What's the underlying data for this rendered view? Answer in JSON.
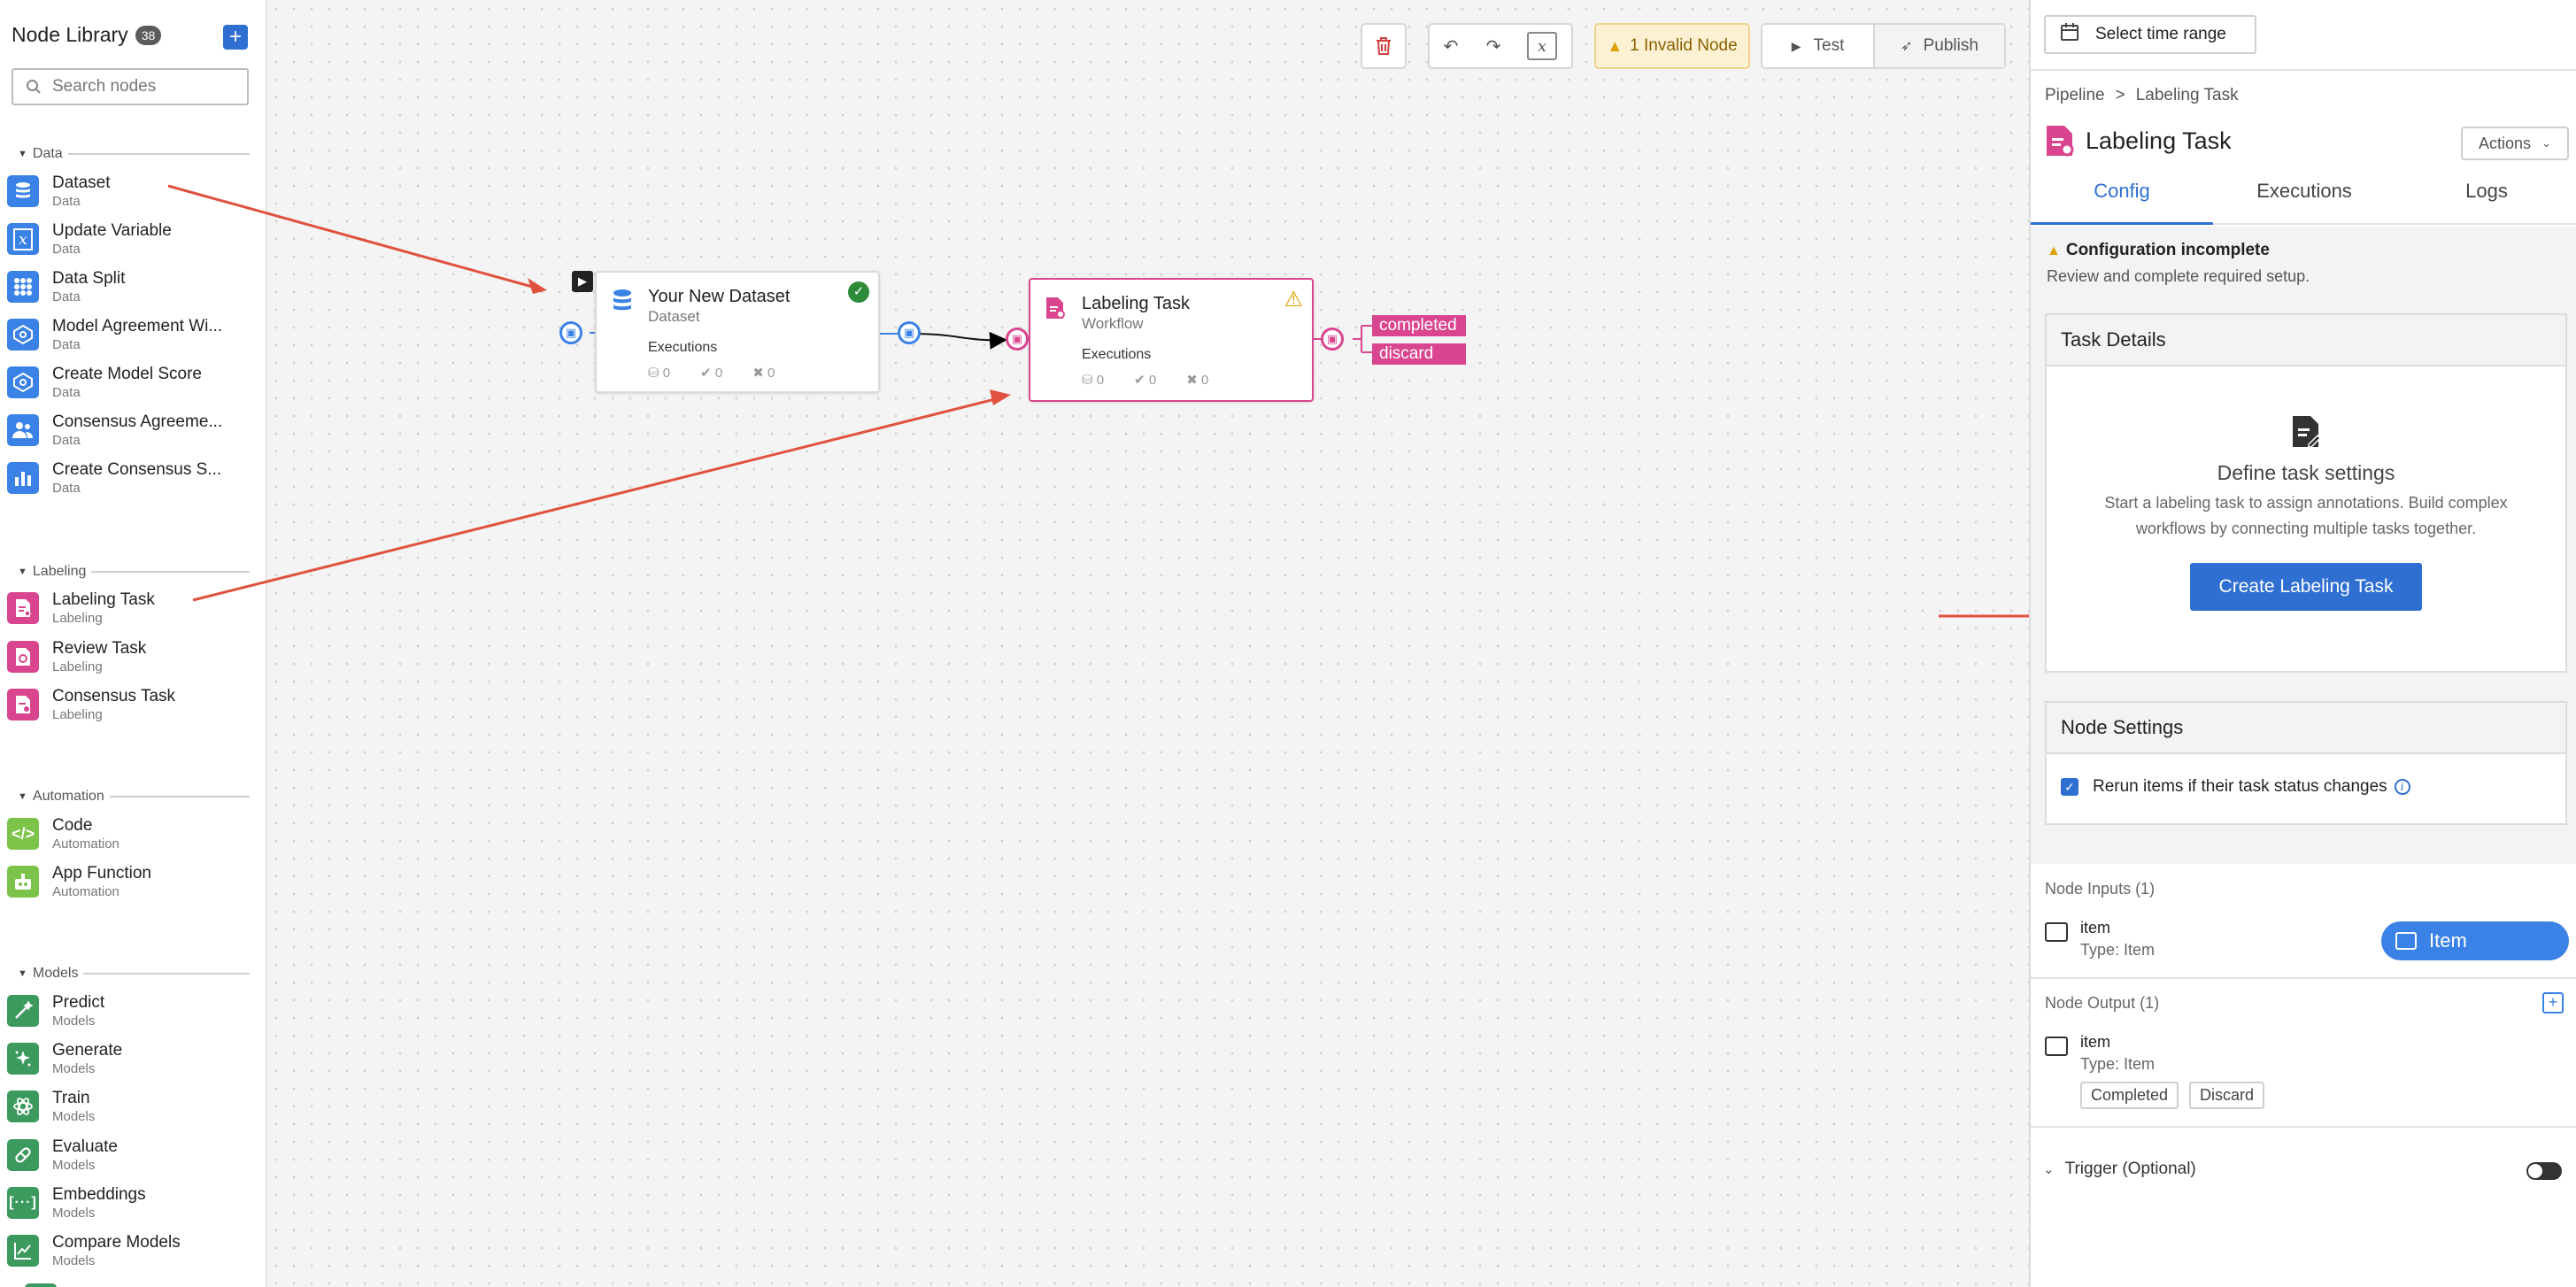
{
  "sidebar": {
    "title": "Node Library",
    "count": "38",
    "search_placeholder": "Search nodes",
    "sections": [
      {
        "label": "Data",
        "items": [
          {
            "name": "Dataset",
            "category": "Data"
          },
          {
            "name": "Update Variable",
            "category": "Data"
          },
          {
            "name": "Data Split",
            "category": "Data"
          },
          {
            "name": "Model Agreement Wi...",
            "category": "Data"
          },
          {
            "name": "Create Model Score",
            "category": "Data"
          },
          {
            "name": "Consensus Agreeme...",
            "category": "Data"
          },
          {
            "name": "Create Consensus S...",
            "category": "Data"
          }
        ]
      },
      {
        "label": "Labeling",
        "items": [
          {
            "name": "Labeling Task",
            "category": "Labeling"
          },
          {
            "name": "Review Task",
            "category": "Labeling"
          },
          {
            "name": "Consensus Task",
            "category": "Labeling"
          }
        ]
      },
      {
        "label": "Automation",
        "items": [
          {
            "name": "Code",
            "category": "Automation"
          },
          {
            "name": "App Function",
            "category": "Automation"
          }
        ]
      },
      {
        "label": "Models",
        "items": [
          {
            "name": "Predict",
            "category": "Models"
          },
          {
            "name": "Generate",
            "category": "Models"
          },
          {
            "name": "Train",
            "category": "Models"
          },
          {
            "name": "Evaluate",
            "category": "Models"
          },
          {
            "name": "Embeddings",
            "category": "Models"
          },
          {
            "name": "Compare Models",
            "category": "Models"
          }
        ]
      }
    ]
  },
  "toolbar": {
    "invalid_label": "1 Invalid Node",
    "test_label": "Test",
    "publish_label": "Publish"
  },
  "canvas": {
    "dataset_node": {
      "title": "Your New Dataset",
      "subtitle": "Dataset",
      "executions_label": "Executions",
      "stats": [
        "0",
        "0",
        "0"
      ]
    },
    "labeling_node": {
      "title": "Labeling Task",
      "subtitle": "Workflow",
      "executions_label": "Executions",
      "stats": [
        "0",
        "0",
        "0"
      ]
    },
    "outputs": [
      "completed",
      "discard"
    ]
  },
  "panel": {
    "time_range": "Select time range",
    "breadcrumb": [
      "Pipeline",
      "Labeling Task"
    ],
    "breadcrumb_sep": ">",
    "title": "Labeling Task",
    "actions_label": "Actions",
    "tabs": [
      "Config",
      "Executions",
      "Logs"
    ],
    "alert_title": "Configuration incomplete",
    "alert_desc": "Review and complete required setup.",
    "task_details": {
      "header": "Task Details",
      "heading": "Define task settings",
      "description": "Start a labeling task to assign annotations. Build complex workflows by connecting multiple tasks together.",
      "button": "Create Labeling Task"
    },
    "node_settings": {
      "header": "Node Settings",
      "rerun_label": "Rerun items if their task status changes"
    },
    "inputs": {
      "label": "Node Inputs (1)",
      "name": "item",
      "type": "Type: Item",
      "pill": "Item"
    },
    "outputs": {
      "label": "Node Output (1)",
      "name": "item",
      "type": "Type: Item",
      "chips": [
        "Completed",
        "Discard"
      ]
    },
    "trigger_label": "Trigger (Optional)"
  },
  "colors": {
    "accent": "#2f6fd1",
    "data": "#3b82e6",
    "labeling": "#d9468f",
    "automation": "#7cc34a",
    "models": "#3d9a5e",
    "arrow": "#e0523f",
    "warning": "#e0a100"
  }
}
